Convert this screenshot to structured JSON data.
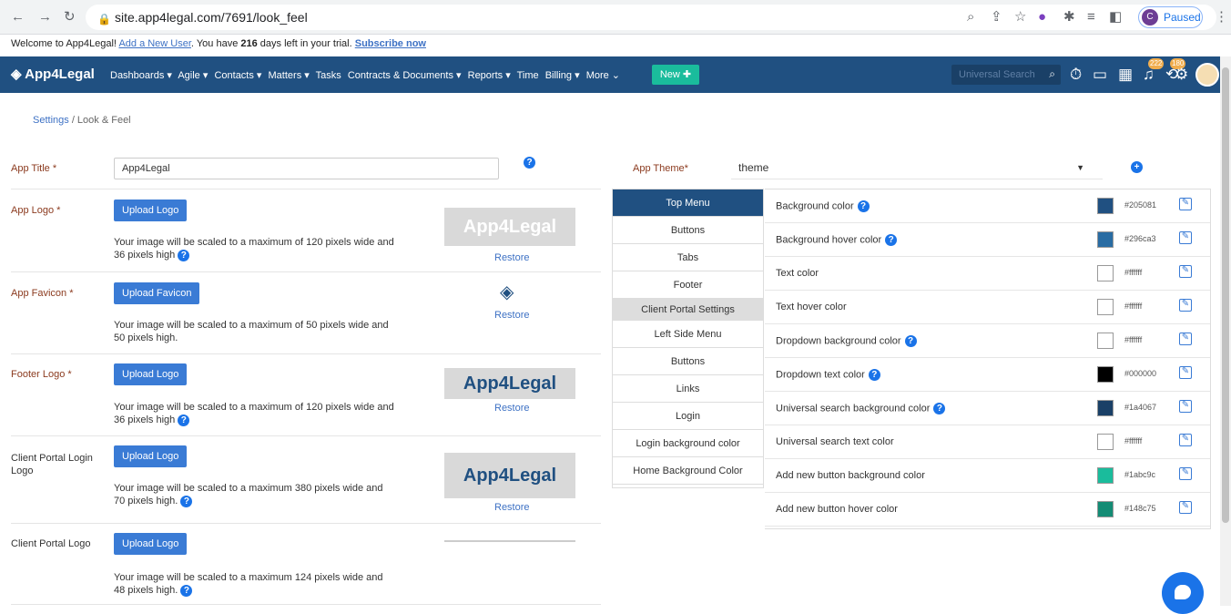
{
  "browser": {
    "url": "site.app4legal.com/7691/look_feel",
    "profile_initial": "C",
    "paused_label": "Paused"
  },
  "trial": {
    "welcome": "Welcome to App4Legal!",
    "add_user": "Add a New User",
    "you_have": ". You have",
    "days": "216",
    "days_left": "days left in your trial.",
    "subscribe": "Subscribe now"
  },
  "nav": {
    "brand": "App4Legal",
    "items": [
      "Dashboards ▾",
      "Agile ▾",
      "Contacts ▾",
      "Matters ▾",
      "Tasks",
      "Contracts & Documents ▾",
      "Reports ▾",
      "Time",
      "Billing ▾",
      "More ⌄"
    ],
    "new_label": "New ✚",
    "search_placeholder": "Universal Search",
    "badge_1": "222",
    "badge_2": "180"
  },
  "breadcrumb": {
    "root": "Settings",
    "current": "/ Look & Feel"
  },
  "form": {
    "app_title_label": "App Title *",
    "app_title_value": "App4Legal",
    "app_logo_label": "App Logo *",
    "upload_logo": "Upload Logo",
    "logo_help": "Your image will be scaled to a maximum of 120 pixels wide and 36 pixels high",
    "app_favicon_label": "App Favicon *",
    "upload_favicon": "Upload Favicon",
    "favicon_help": "Your image will be scaled to a maximum of 50 pixels wide and 50 pixels high.",
    "footer_logo_label": "Footer Logo *",
    "footer_help": "Your image will be scaled to a maximum of 120 pixels wide and 36 pixels high",
    "cp_login_logo_label": "Client Portal Login Logo",
    "cp_login_help": "Your image will be scaled to a maximum 380 pixels wide and 70 pixels high.",
    "cp_logo_label": "Client Portal Logo",
    "cp_logo_help": "Your image will be scaled to a maximum 124 pixels wide and 48 pixels high.",
    "restore": "Restore",
    "logo_text": "App4Legal"
  },
  "theme": {
    "label": "App Theme*",
    "value": "theme"
  },
  "sidenav": [
    "Top Menu",
    "Buttons",
    "Tabs",
    "Footer",
    "Client Portal Settings",
    "Left Side Menu",
    "Buttons",
    "Links",
    "Login",
    "Login background color",
    "Home Background Color"
  ],
  "colors": [
    {
      "name": "Background color",
      "hex": "#205081",
      "help": true
    },
    {
      "name": "Background hover color",
      "hex": "#296ca3",
      "help": true
    },
    {
      "name": "Text color",
      "hex": "#ffffff",
      "help": false
    },
    {
      "name": "Text hover color",
      "hex": "#ffffff",
      "help": false
    },
    {
      "name": "Dropdown background color",
      "hex": "#ffffff",
      "help": true
    },
    {
      "name": "Dropdown text color",
      "hex": "#000000",
      "help": true
    },
    {
      "name": "Universal search background color",
      "hex": "#1a4067",
      "help": true
    },
    {
      "name": "Universal search text color",
      "hex": "#ffffff",
      "help": false
    },
    {
      "name": "Add new button background color",
      "hex": "#1abc9c",
      "help": false
    },
    {
      "name": "Add new button hover color",
      "hex": "#148c75",
      "help": false
    }
  ]
}
